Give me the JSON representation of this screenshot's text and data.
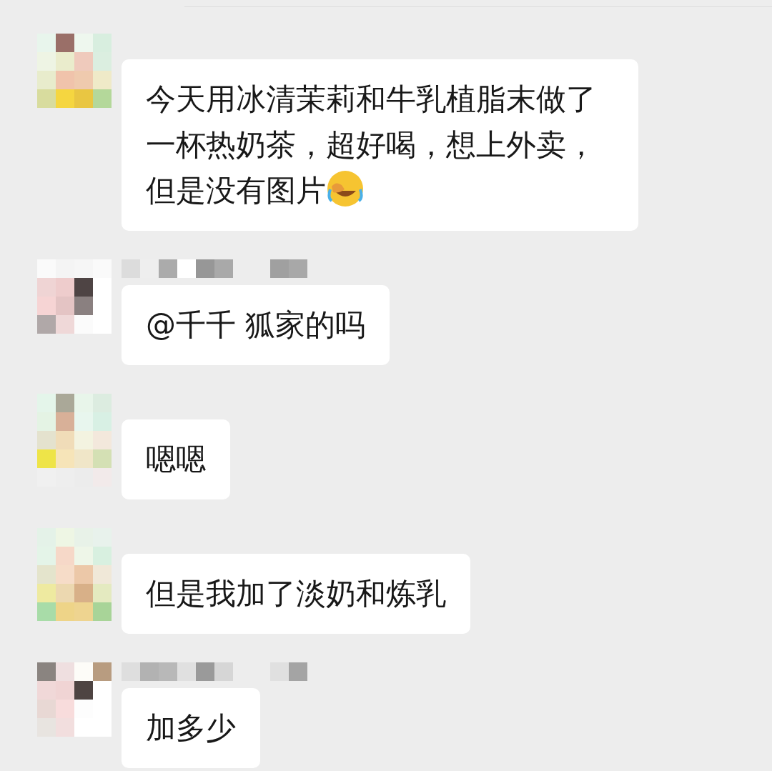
{
  "messages": [
    {
      "text": "今天用冰清茉莉和牛乳植脂末做了一杯热奶茶，超好喝，想上外卖，但是没有图片",
      "emoji": true
    },
    {
      "text": "@千千  狐家的吗",
      "emoji": false
    },
    {
      "text": "嗯嗯",
      "emoji": false
    },
    {
      "text": "但是我加了淡奶和炼乳",
      "emoji": false
    },
    {
      "text": "加多少",
      "emoji": false
    }
  ]
}
